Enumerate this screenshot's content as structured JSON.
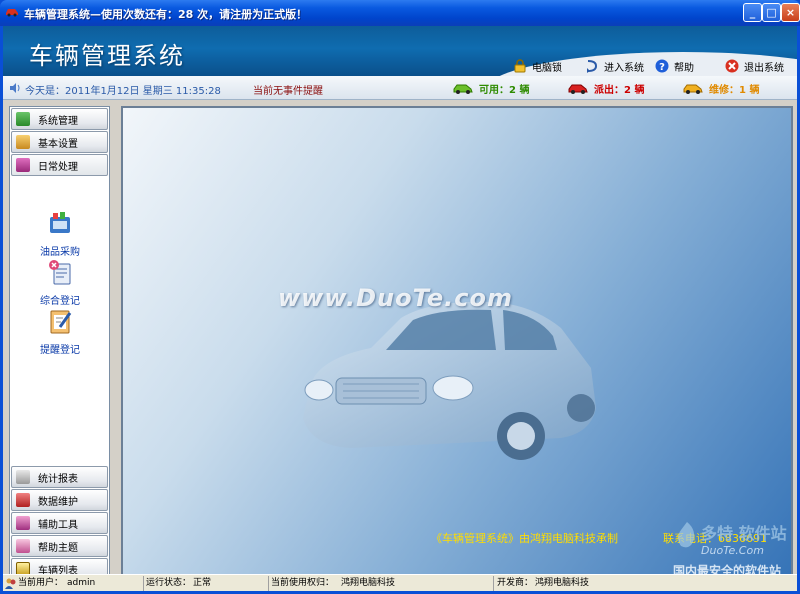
{
  "window": {
    "title": "车辆管理系统—使用次数还有：28 次，请注册为正式版！",
    "controls": [
      "_",
      "□",
      "×"
    ]
  },
  "header": {
    "app_title": "车辆管理系统",
    "toolbar": [
      {
        "label": "电脑锁",
        "icon": "lock-icon"
      },
      {
        "label": "进入系统",
        "icon": "enter-icon"
      },
      {
        "label": "帮助",
        "icon": "help-icon"
      },
      {
        "label": "退出系统",
        "icon": "exit-icon"
      }
    ]
  },
  "infobar": {
    "date": "今天是：2011年1月12日   星期三  11:35:28",
    "event": "当前无事件提醒",
    "status": [
      {
        "label": "可用：",
        "count": "2",
        "unit": "辆",
        "color": "#2e8b00"
      },
      {
        "label": "派出：",
        "count": "2",
        "unit": "辆",
        "color": "#cc0000"
      },
      {
        "label": "维修：",
        "count": "1",
        "unit": "辆",
        "color": "#e08a00"
      }
    ]
  },
  "sidebar": {
    "top_items": [
      {
        "label": "系统管理"
      },
      {
        "label": "基本设置"
      },
      {
        "label": "日常处理"
      }
    ],
    "tools": [
      {
        "label": "油品采购"
      },
      {
        "label": "综合登记"
      },
      {
        "label": "提醒登记"
      }
    ],
    "bottom_items": [
      {
        "label": "统计报表"
      },
      {
        "label": "数据维护"
      },
      {
        "label": "辅助工具"
      },
      {
        "label": "帮助主题"
      },
      {
        "label": "车辆列表"
      }
    ]
  },
  "content": {
    "watermark": "www.DuoTe.com",
    "credit": "《车辆管理系统》由鸿翔电脑科技承制",
    "phone": "联系电话：6836691",
    "logo_line1": "多特 软件站",
    "logo_line2": "DuoTe.Com",
    "logo_line3": "国内最安全的软件站"
  },
  "statusbar": {
    "user_label": "当前用户：",
    "user": "admin",
    "run_label": "运行状态：",
    "run": "正常",
    "licensee_label": "当前使用权归：",
    "licensee": "鸿翔电脑科技",
    "dev_label": "开发商：",
    "dev": "鸿翔电脑科技"
  }
}
